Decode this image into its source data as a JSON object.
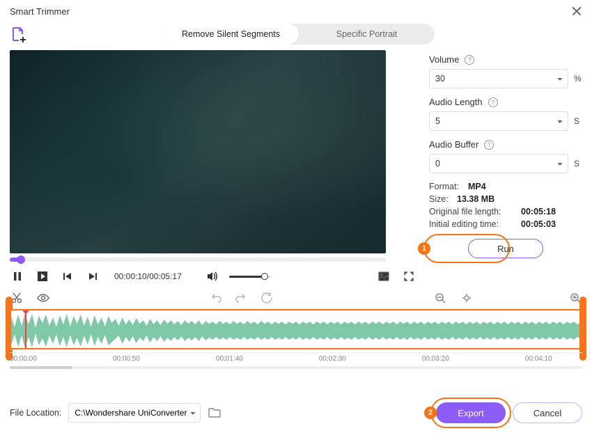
{
  "title": "Smart Trimmer",
  "tabs": {
    "remove": "Remove Silent Segments",
    "portrait": "Specific Portrait"
  },
  "player": {
    "time_current": "00:00:10",
    "time_total": "00:05:17"
  },
  "settings": {
    "volume_label": "Volume",
    "volume_value": "30",
    "volume_unit": "%",
    "length_label": "Audio Length",
    "length_value": "5",
    "length_unit": "S",
    "buffer_label": "Audio Buffer",
    "buffer_value": "0",
    "buffer_unit": "S"
  },
  "info": {
    "format_k": "Format:",
    "format_v": "MP4",
    "size_k": "Size:",
    "size_v": "13.38 MB",
    "orig_k": "Original file length:",
    "orig_v": "00:05:18",
    "edit_k": "Initial editing time:",
    "edit_v": "00:05:03"
  },
  "run_label": "Run",
  "callouts": {
    "one": "1",
    "two": "2"
  },
  "ruler": [
    "00:00:00",
    "00:00:50",
    "00:01:40",
    "00:02:30",
    "00:03:20",
    "00:04:10"
  ],
  "footer": {
    "location_label": "File Location:",
    "location_value": "C:\\Wondershare UniConverter",
    "export": "Export",
    "cancel": "Cancel"
  }
}
